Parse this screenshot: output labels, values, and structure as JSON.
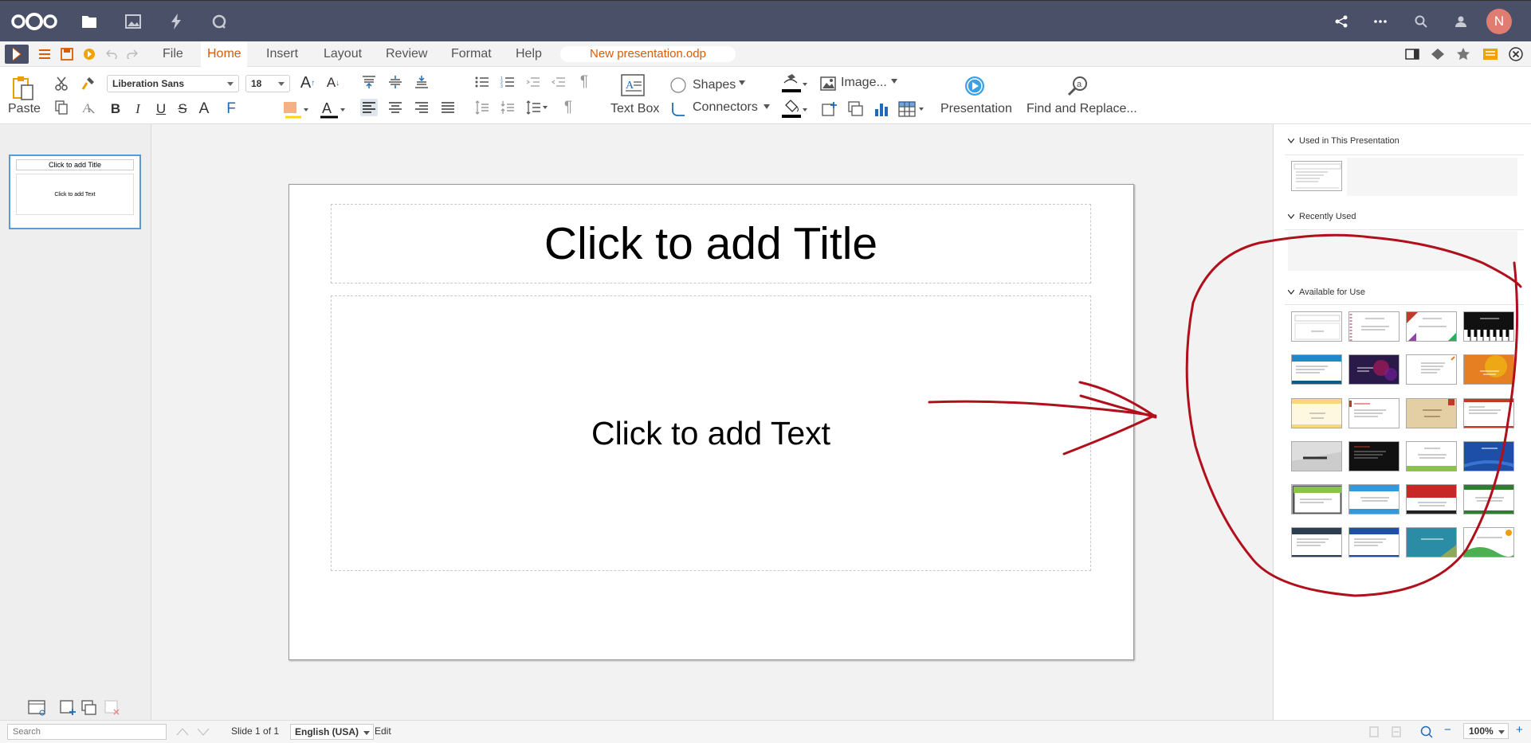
{
  "nav": {
    "apps": [
      "files-icon",
      "photos-icon",
      "activity-icon",
      "search-app-icon"
    ],
    "avatar_letter": "N"
  },
  "menubar": {
    "tabs": [
      "File",
      "Home",
      "Insert",
      "Layout",
      "Review",
      "Format",
      "Help"
    ],
    "active_tab": "Home",
    "filename": "New presentation.odp"
  },
  "ribbon": {
    "paste": "Paste",
    "font_name": "Liberation Sans",
    "font_size": "18",
    "text_box": "Text Box",
    "shapes": "Shapes",
    "connectors": "Connectors",
    "image": "Image...",
    "presentation": "Presentation",
    "find_replace": "Find and Replace..."
  },
  "slide_thumb": {
    "title": "Click to add Title",
    "text": "Click to add Text"
  },
  "slide": {
    "title": "Click to add Title",
    "text": "Click to add Text"
  },
  "sidebar": {
    "used_header": "Used in This Presentation",
    "recent_header": "Recently Used",
    "available_header": "Available for Use"
  },
  "status": {
    "search_placeholder": "Search",
    "slide_info": "Slide 1 of 1",
    "language": "English (USA)",
    "mode": "Edit",
    "zoom": "100%"
  },
  "colors": {
    "header": "#4a5068",
    "accent": "#d95c06",
    "annotation": "#b0101c"
  }
}
